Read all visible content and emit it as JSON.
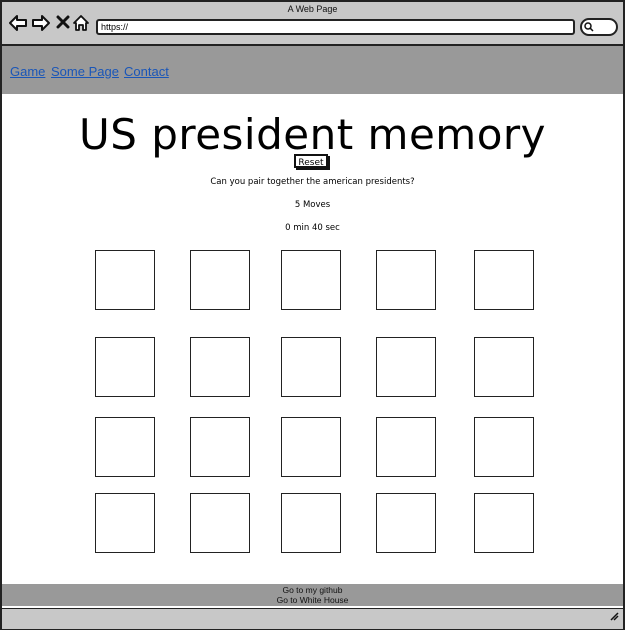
{
  "window": {
    "title": "A Web Page"
  },
  "toolbar": {
    "back_icon": "arrow-left-icon",
    "forward_icon": "arrow-right-icon",
    "stop_icon": "close-icon",
    "home_icon": "home-icon",
    "url": "https://",
    "search_icon": "search-icon"
  },
  "nav": {
    "items": [
      {
        "label": "Game"
      },
      {
        "label": "Some Page"
      },
      {
        "label": "Contact"
      }
    ]
  },
  "main": {
    "title": "US president memory",
    "reset_label": "Reset",
    "subtitle": "Can you pair together the american presidents?",
    "moves": "5 Moves",
    "timer": "0 min 40 sec",
    "cards": [
      {
        "row": 1,
        "col": 1
      },
      {
        "row": 1,
        "col": 2
      },
      {
        "row": 1,
        "col": 3
      },
      {
        "row": 1,
        "col": 4
      },
      {
        "row": 1,
        "col": 5
      },
      {
        "row": 2,
        "col": 1
      },
      {
        "row": 2,
        "col": 2
      },
      {
        "row": 2,
        "col": 3
      },
      {
        "row": 2,
        "col": 4
      },
      {
        "row": 2,
        "col": 5
      },
      {
        "row": 3,
        "col": 1
      },
      {
        "row": 3,
        "col": 2
      },
      {
        "row": 3,
        "col": 3
      },
      {
        "row": 3,
        "col": 4
      },
      {
        "row": 3,
        "col": 5
      },
      {
        "row": 4,
        "col": 1
      },
      {
        "row": 4,
        "col": 2
      },
      {
        "row": 4,
        "col": 3
      },
      {
        "row": 4,
        "col": 4
      },
      {
        "row": 4,
        "col": 5
      }
    ]
  },
  "footer": {
    "github_link": "Go to my github",
    "whitehouse_link": "Go to White House"
  },
  "colors": {
    "chrome": "#c8c8c8",
    "header": "#999999",
    "link": "#1a56b8"
  }
}
